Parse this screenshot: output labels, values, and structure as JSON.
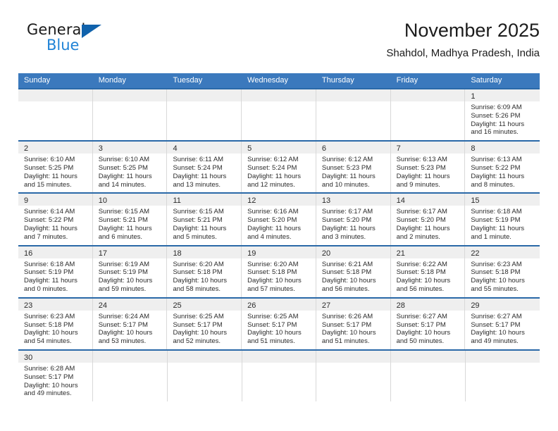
{
  "brand": {
    "line1": "General",
    "line2": "Blue",
    "triangle_color": "#1062ac",
    "blue_text_color": "#2083d6"
  },
  "header": {
    "title": "November 2025",
    "subtitle": "Shahdol, Madhya Pradesh, India"
  },
  "colors": {
    "header_blue": "#3b79bd",
    "row_rule_blue": "#2a69a8",
    "daynum_band": "#efefef",
    "column_divider": "#d8d8d8"
  },
  "labels": {
    "sunrise_prefix": "Sunrise:",
    "sunset_prefix": "Sunset:",
    "daylight_prefix": "Daylight:"
  },
  "weekdays": [
    "Sunday",
    "Monday",
    "Tuesday",
    "Wednesday",
    "Thursday",
    "Friday",
    "Saturday"
  ],
  "weeks": [
    [
      {
        "empty": true
      },
      {
        "empty": true
      },
      {
        "empty": true
      },
      {
        "empty": true
      },
      {
        "empty": true
      },
      {
        "empty": true
      },
      {
        "day": "1",
        "sunrise": "Sunrise: 6:09 AM",
        "sunset": "Sunset: 5:26 PM",
        "daylight": "Daylight: 11 hours and 16 minutes."
      }
    ],
    [
      {
        "day": "2",
        "sunrise": "Sunrise: 6:10 AM",
        "sunset": "Sunset: 5:25 PM",
        "daylight": "Daylight: 11 hours and 15 minutes."
      },
      {
        "day": "3",
        "sunrise": "Sunrise: 6:10 AM",
        "sunset": "Sunset: 5:25 PM",
        "daylight": "Daylight: 11 hours and 14 minutes."
      },
      {
        "day": "4",
        "sunrise": "Sunrise: 6:11 AM",
        "sunset": "Sunset: 5:24 PM",
        "daylight": "Daylight: 11 hours and 13 minutes."
      },
      {
        "day": "5",
        "sunrise": "Sunrise: 6:12 AM",
        "sunset": "Sunset: 5:24 PM",
        "daylight": "Daylight: 11 hours and 12 minutes."
      },
      {
        "day": "6",
        "sunrise": "Sunrise: 6:12 AM",
        "sunset": "Sunset: 5:23 PM",
        "daylight": "Daylight: 11 hours and 10 minutes."
      },
      {
        "day": "7",
        "sunrise": "Sunrise: 6:13 AM",
        "sunset": "Sunset: 5:23 PM",
        "daylight": "Daylight: 11 hours and 9 minutes."
      },
      {
        "day": "8",
        "sunrise": "Sunrise: 6:13 AM",
        "sunset": "Sunset: 5:22 PM",
        "daylight": "Daylight: 11 hours and 8 minutes."
      }
    ],
    [
      {
        "day": "9",
        "sunrise": "Sunrise: 6:14 AM",
        "sunset": "Sunset: 5:22 PM",
        "daylight": "Daylight: 11 hours and 7 minutes."
      },
      {
        "day": "10",
        "sunrise": "Sunrise: 6:15 AM",
        "sunset": "Sunset: 5:21 PM",
        "daylight": "Daylight: 11 hours and 6 minutes."
      },
      {
        "day": "11",
        "sunrise": "Sunrise: 6:15 AM",
        "sunset": "Sunset: 5:21 PM",
        "daylight": "Daylight: 11 hours and 5 minutes."
      },
      {
        "day": "12",
        "sunrise": "Sunrise: 6:16 AM",
        "sunset": "Sunset: 5:20 PM",
        "daylight": "Daylight: 11 hours and 4 minutes."
      },
      {
        "day": "13",
        "sunrise": "Sunrise: 6:17 AM",
        "sunset": "Sunset: 5:20 PM",
        "daylight": "Daylight: 11 hours and 3 minutes."
      },
      {
        "day": "14",
        "sunrise": "Sunrise: 6:17 AM",
        "sunset": "Sunset: 5:20 PM",
        "daylight": "Daylight: 11 hours and 2 minutes."
      },
      {
        "day": "15",
        "sunrise": "Sunrise: 6:18 AM",
        "sunset": "Sunset: 5:19 PM",
        "daylight": "Daylight: 11 hours and 1 minute."
      }
    ],
    [
      {
        "day": "16",
        "sunrise": "Sunrise: 6:18 AM",
        "sunset": "Sunset: 5:19 PM",
        "daylight": "Daylight: 11 hours and 0 minutes."
      },
      {
        "day": "17",
        "sunrise": "Sunrise: 6:19 AM",
        "sunset": "Sunset: 5:19 PM",
        "daylight": "Daylight: 10 hours and 59 minutes."
      },
      {
        "day": "18",
        "sunrise": "Sunrise: 6:20 AM",
        "sunset": "Sunset: 5:18 PM",
        "daylight": "Daylight: 10 hours and 58 minutes."
      },
      {
        "day": "19",
        "sunrise": "Sunrise: 6:20 AM",
        "sunset": "Sunset: 5:18 PM",
        "daylight": "Daylight: 10 hours and 57 minutes."
      },
      {
        "day": "20",
        "sunrise": "Sunrise: 6:21 AM",
        "sunset": "Sunset: 5:18 PM",
        "daylight": "Daylight: 10 hours and 56 minutes."
      },
      {
        "day": "21",
        "sunrise": "Sunrise: 6:22 AM",
        "sunset": "Sunset: 5:18 PM",
        "daylight": "Daylight: 10 hours and 56 minutes."
      },
      {
        "day": "22",
        "sunrise": "Sunrise: 6:23 AM",
        "sunset": "Sunset: 5:18 PM",
        "daylight": "Daylight: 10 hours and 55 minutes."
      }
    ],
    [
      {
        "day": "23",
        "sunrise": "Sunrise: 6:23 AM",
        "sunset": "Sunset: 5:18 PM",
        "daylight": "Daylight: 10 hours and 54 minutes."
      },
      {
        "day": "24",
        "sunrise": "Sunrise: 6:24 AM",
        "sunset": "Sunset: 5:17 PM",
        "daylight": "Daylight: 10 hours and 53 minutes."
      },
      {
        "day": "25",
        "sunrise": "Sunrise: 6:25 AM",
        "sunset": "Sunset: 5:17 PM",
        "daylight": "Daylight: 10 hours and 52 minutes."
      },
      {
        "day": "26",
        "sunrise": "Sunrise: 6:25 AM",
        "sunset": "Sunset: 5:17 PM",
        "daylight": "Daylight: 10 hours and 51 minutes."
      },
      {
        "day": "27",
        "sunrise": "Sunrise: 6:26 AM",
        "sunset": "Sunset: 5:17 PM",
        "daylight": "Daylight: 10 hours and 51 minutes."
      },
      {
        "day": "28",
        "sunrise": "Sunrise: 6:27 AM",
        "sunset": "Sunset: 5:17 PM",
        "daylight": "Daylight: 10 hours and 50 minutes."
      },
      {
        "day": "29",
        "sunrise": "Sunrise: 6:27 AM",
        "sunset": "Sunset: 5:17 PM",
        "daylight": "Daylight: 10 hours and 49 minutes."
      }
    ],
    [
      {
        "day": "30",
        "sunrise": "Sunrise: 6:28 AM",
        "sunset": "Sunset: 5:17 PM",
        "daylight": "Daylight: 10 hours and 49 minutes."
      },
      {
        "empty": true
      },
      {
        "empty": true
      },
      {
        "empty": true
      },
      {
        "empty": true
      },
      {
        "empty": true
      },
      {
        "empty": true
      }
    ]
  ]
}
